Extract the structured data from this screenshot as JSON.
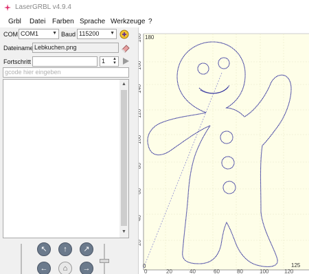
{
  "window": {
    "title": "LaserGRBL v4.9.4",
    "icon": "laser-logo-icon",
    "accent": "#e0306e"
  },
  "menu": [
    "Grbl",
    "Datei",
    "Farben",
    "Sprache",
    "Werkzeuge",
    "?"
  ],
  "connection": {
    "com_label": "COM",
    "com_value": "COM1",
    "baud_label": "Baud",
    "baud_value": "115200",
    "connect_icon": "connect-icon"
  },
  "file": {
    "label": "Dateiname",
    "value": "Lebkuchen.png",
    "open_icon": "eraser-icon"
  },
  "progress": {
    "label": "Fortschritt",
    "count": "1",
    "run_icon": "play-icon"
  },
  "gcode": {
    "placeholder": "gcode hier eingeben"
  },
  "canvas": {
    "background": "#fefee8",
    "outline_color": "#2a2a9a",
    "y_ticks": [
      "180",
      "160",
      "140",
      "120",
      "100",
      "80",
      "60",
      "40",
      "20"
    ],
    "x_ticks": [
      "0",
      "20",
      "40",
      "60",
      "80",
      "100",
      "120"
    ],
    "corner_top": "180",
    "corner_left": "0",
    "corner_right": "125",
    "corner_origin": "0"
  }
}
